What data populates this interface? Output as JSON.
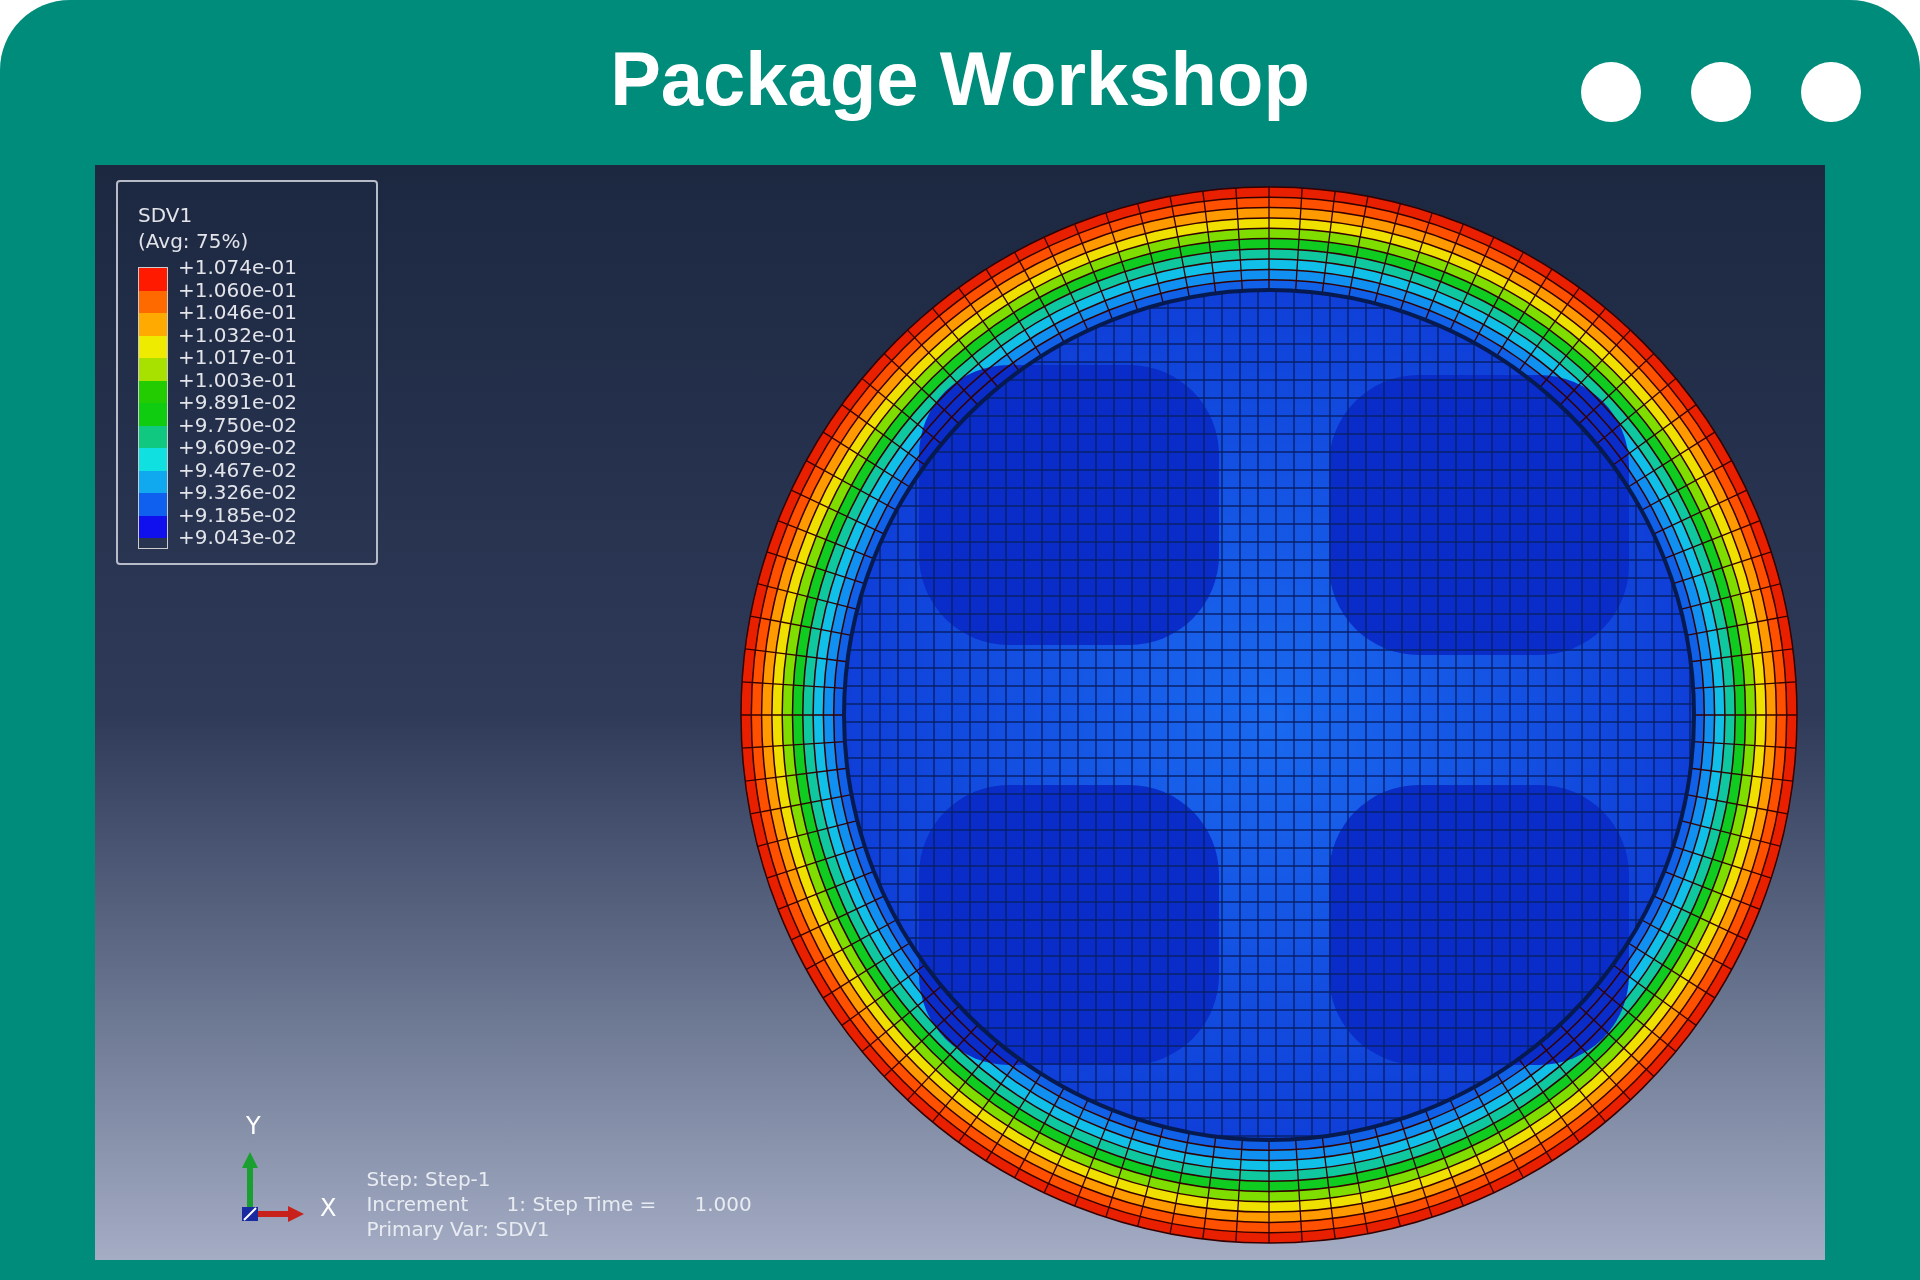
{
  "window": {
    "title": "Package Workshop"
  },
  "legend": {
    "title": "SDV1",
    "subtitle": "(Avg: 75%)",
    "bands": [
      {
        "color": "#ff1a00"
      },
      {
        "color": "#ff6a00"
      },
      {
        "color": "#ffaa00"
      },
      {
        "color": "#eeea00"
      },
      {
        "color": "#a8e000"
      },
      {
        "color": "#22cc00"
      },
      {
        "color": "#10cc10"
      },
      {
        "color": "#10c880"
      },
      {
        "color": "#10e0e0"
      },
      {
        "color": "#10a8ee"
      },
      {
        "color": "#1060f0"
      },
      {
        "color": "#1010ee"
      }
    ],
    "labels": [
      "+1.074e-01",
      "+1.060e-01",
      "+1.046e-01",
      "+1.032e-01",
      "+1.017e-01",
      "+1.003e-01",
      "+9.891e-02",
      "+9.750e-02",
      "+9.609e-02",
      "+9.467e-02",
      "+9.326e-02",
      "+9.185e-02",
      "+9.043e-02"
    ]
  },
  "triad": {
    "y_label": "Y",
    "x_label": "X"
  },
  "info": [
    "Step: Step-1",
    "Increment      1: Step Time =      1.000",
    "Primary Var: SDV1"
  ]
}
